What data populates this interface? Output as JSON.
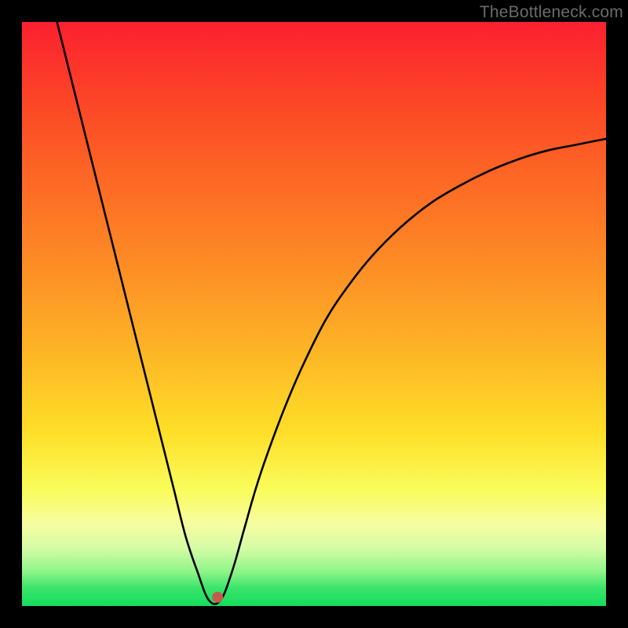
{
  "watermark": {
    "text": "TheBottleneck.com"
  },
  "chart_data": {
    "type": "line",
    "title": "",
    "xlabel": "",
    "ylabel": "",
    "xlim": [
      0,
      100
    ],
    "ylim": [
      0,
      100
    ],
    "grid": false,
    "legend": false,
    "notch_x": 32,
    "marker": {
      "x": 33.5,
      "y": 1.5,
      "color": "#c55a4e",
      "r": 7
    },
    "series": [
      {
        "name": "bottleneck-curve",
        "x": [
          6,
          8,
          10,
          12,
          14,
          16,
          18,
          20,
          22,
          24,
          26,
          28,
          30,
          32,
          34,
          36,
          38,
          40,
          42,
          45,
          48,
          52,
          56,
          60,
          65,
          70,
          75,
          80,
          85,
          90,
          95,
          100
        ],
        "values": [
          100,
          92,
          84,
          76,
          68,
          60,
          52,
          44,
          36,
          28,
          20,
          12,
          6,
          1,
          1,
          6,
          13,
          20,
          26,
          34,
          41,
          49,
          55,
          60,
          65,
          69,
          72,
          74.5,
          76.5,
          78,
          79,
          80
        ]
      }
    ]
  }
}
